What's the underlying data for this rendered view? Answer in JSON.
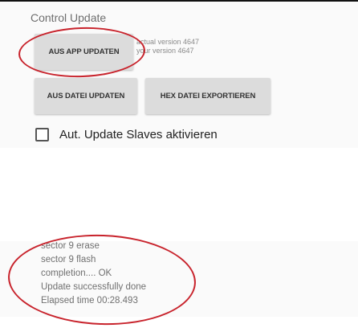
{
  "section": {
    "title": "Control Update"
  },
  "buttons": {
    "update_from_app": "AUS APP UPDATEN",
    "update_from_file": "AUS DATEI UPDATEN",
    "export_hex": "HEX DATEI EXPORTIEREN"
  },
  "version": {
    "actual": "actual version 4647",
    "yours": "your version 4647"
  },
  "checkbox": {
    "label": "Aut. Update Slaves aktivieren",
    "checked": false
  },
  "log": {
    "lines": [
      "sector 9 erase",
      "sector 9 flash",
      "completion.... OK",
      "Update successfully done",
      "Elapsed time 00:28.493"
    ]
  },
  "annotation_color": "#c8232c"
}
